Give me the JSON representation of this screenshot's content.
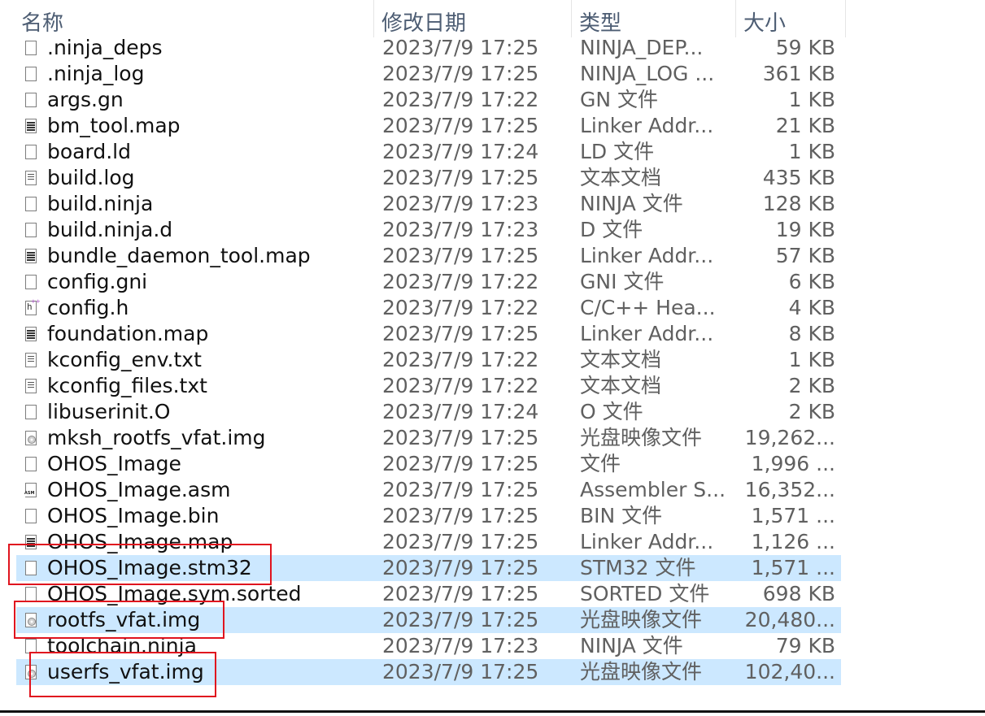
{
  "header": {
    "name": "名称",
    "date_modified": "修改日期",
    "type": "类型",
    "size": "大小",
    "sort_indicator": "chevron-up-icon"
  },
  "files": [
    {
      "name": ".ninja_deps",
      "date": "2023/7/9 17:25",
      "type": "NINJA_DEP...",
      "size": "59 KB",
      "icon": "file-icon",
      "selected": false
    },
    {
      "name": ".ninja_log",
      "date": "2023/7/9 17:25",
      "type": "NINJA_LOG ...",
      "size": "361 KB",
      "icon": "file-icon",
      "selected": false
    },
    {
      "name": "args.gn",
      "date": "2023/7/9 17:22",
      "type": "GN 文件",
      "size": "1 KB",
      "icon": "file-icon",
      "selected": false
    },
    {
      "name": "bm_tool.map",
      "date": "2023/7/9 17:25",
      "type": "Linker Addr...",
      "size": "21 KB",
      "icon": "map-file-icon",
      "selected": false
    },
    {
      "name": "board.ld",
      "date": "2023/7/9 17:24",
      "type": "LD 文件",
      "size": "1 KB",
      "icon": "file-icon",
      "selected": false
    },
    {
      "name": "build.log",
      "date": "2023/7/9 17:25",
      "type": "文本文档",
      "size": "435 KB",
      "icon": "text-file-icon",
      "selected": false
    },
    {
      "name": "build.ninja",
      "date": "2023/7/9 17:23",
      "type": "NINJA 文件",
      "size": "128 KB",
      "icon": "file-icon",
      "selected": false
    },
    {
      "name": "build.ninja.d",
      "date": "2023/7/9 17:23",
      "type": "D 文件",
      "size": "19 KB",
      "icon": "file-icon",
      "selected": false
    },
    {
      "name": "bundle_daemon_tool.map",
      "date": "2023/7/9 17:25",
      "type": "Linker Addr...",
      "size": "57 KB",
      "icon": "map-file-icon",
      "selected": false
    },
    {
      "name": "config.gni",
      "date": "2023/7/9 17:22",
      "type": "GNI 文件",
      "size": "6 KB",
      "icon": "file-icon",
      "selected": false
    },
    {
      "name": "config.h",
      "date": "2023/7/9 17:22",
      "type": "C/C++ Hea...",
      "size": "4 KB",
      "icon": "header-file-icon",
      "selected": false
    },
    {
      "name": "foundation.map",
      "date": "2023/7/9 17:25",
      "type": "Linker Addr...",
      "size": "8 KB",
      "icon": "map-file-icon",
      "selected": false
    },
    {
      "name": "kconfig_env.txt",
      "date": "2023/7/9 17:22",
      "type": "文本文档",
      "size": "1 KB",
      "icon": "text-file-icon",
      "selected": false
    },
    {
      "name": "kconfig_files.txt",
      "date": "2023/7/9 17:22",
      "type": "文本文档",
      "size": "2 KB",
      "icon": "text-file-icon",
      "selected": false
    },
    {
      "name": "libuserinit.O",
      "date": "2023/7/9 17:24",
      "type": "O 文件",
      "size": "2 KB",
      "icon": "file-icon",
      "selected": false
    },
    {
      "name": "mksh_rootfs_vfat.img",
      "date": "2023/7/9 17:25",
      "type": "光盘映像文件",
      "size": "19,262...",
      "icon": "disc-image-icon",
      "selected": false
    },
    {
      "name": "OHOS_Image",
      "date": "2023/7/9 17:25",
      "type": "文件",
      "size": "1,996 ...",
      "icon": "file-icon",
      "selected": false
    },
    {
      "name": "OHOS_Image.asm",
      "date": "2023/7/9 17:25",
      "type": "Assembler S...",
      "size": "16,352...",
      "icon": "asm-file-icon",
      "selected": false
    },
    {
      "name": "OHOS_Image.bin",
      "date": "2023/7/9 17:25",
      "type": "BIN 文件",
      "size": "1,571 ...",
      "icon": "file-icon",
      "selected": false
    },
    {
      "name": "OHOS_Image.map",
      "date": "2023/7/9 17:25",
      "type": "Linker Addr...",
      "size": "1,126 ...",
      "icon": "map-file-icon",
      "selected": false
    },
    {
      "name": "OHOS_Image.stm32",
      "date": "2023/7/9 17:25",
      "type": "STM32 文件",
      "size": "1,571 ...",
      "icon": "file-icon",
      "selected": true
    },
    {
      "name": "OHOS_Image.sym.sorted",
      "date": "2023/7/9 17:25",
      "type": "SORTED 文件",
      "size": "698 KB",
      "icon": "file-icon",
      "selected": false
    },
    {
      "name": "rootfs_vfat.img",
      "date": "2023/7/9 17:25",
      "type": "光盘映像文件",
      "size": "20,480...",
      "icon": "disc-image-icon",
      "selected": true
    },
    {
      "name": "toolchain.ninja",
      "date": "2023/7/9 17:23",
      "type": "NINJA 文件",
      "size": "79 KB",
      "icon": "file-icon",
      "selected": false
    },
    {
      "name": "userfs_vfat.img",
      "date": "2023/7/9 17:25",
      "type": "光盘映像文件",
      "size": "102,40...",
      "icon": "disc-image-icon",
      "selected": true
    }
  ],
  "colors": {
    "selection": "#cce8ff",
    "highlight_box": "#e0141e",
    "header_text": "#4d5d73"
  }
}
